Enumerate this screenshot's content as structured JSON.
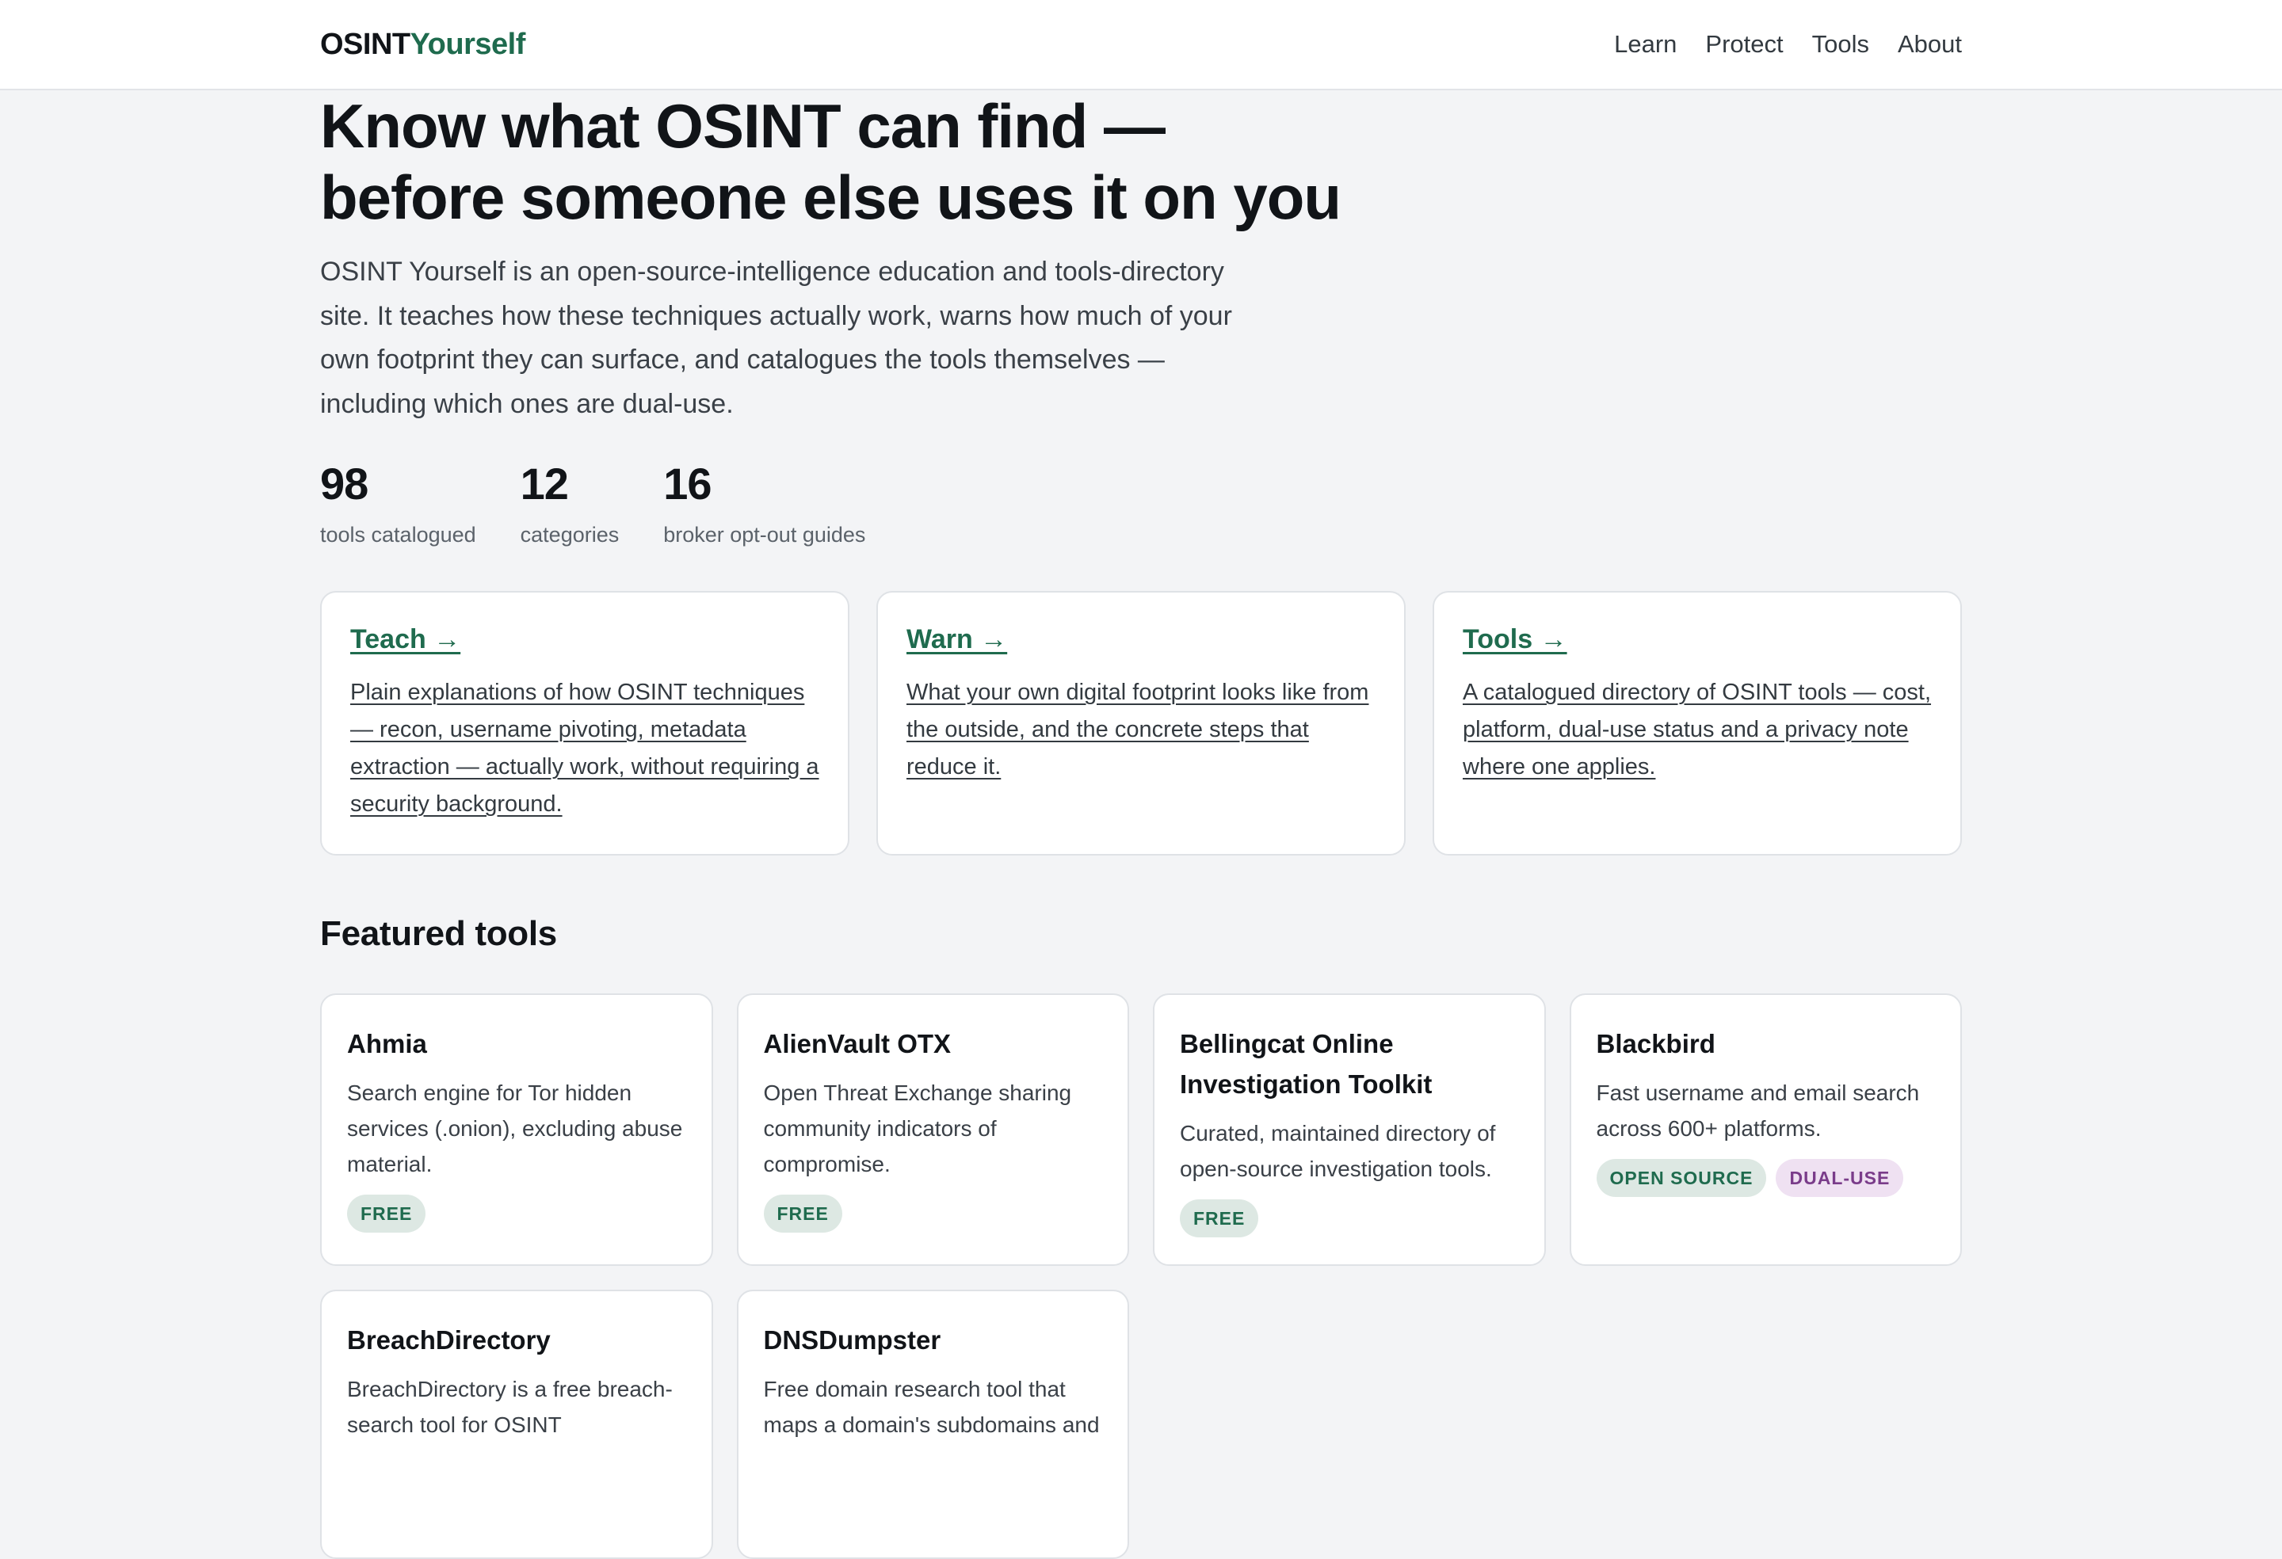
{
  "header": {
    "logo_part1": "OSINT",
    "logo_part2": "Yourself",
    "nav": [
      "Learn",
      "Protect",
      "Tools",
      "About"
    ]
  },
  "hero": {
    "title_line1": "Know what OSINT can find —",
    "title_line2": "before someone else uses it on you",
    "lede": "OSINT Yourself is an open-source-intelligence education and tools-directory site. It teaches how these techniques actually work, warns how much of your own footprint they can surface, and catalogues the tools themselves — including which ones are dual-use."
  },
  "stats": [
    {
      "value": "98",
      "label": "tools catalogued"
    },
    {
      "value": "12",
      "label": "categories"
    },
    {
      "value": "16",
      "label": "broker opt-out guides"
    }
  ],
  "pillars": [
    {
      "title": "Teach →",
      "desc": "Plain explanations of how OSINT techniques — recon, username pivoting, metadata extraction — actually work, without requiring a security background."
    },
    {
      "title": "Warn →",
      "desc": "What your own digital footprint looks like from the outside, and the concrete steps that reduce it."
    },
    {
      "title": "Tools →",
      "desc": "A catalogued directory of OSINT tools — cost, platform, dual-use status and a privacy note where one applies."
    }
  ],
  "featured": {
    "title": "Featured tools",
    "tools": [
      {
        "name": "Ahmia",
        "desc": "Search engine for Tor hidden services (.onion), excluding abuse material.",
        "tags": [
          "FREE"
        ]
      },
      {
        "name": "AlienVault OTX",
        "desc": "Open Threat Exchange sharing community indicators of compromise.",
        "tags": [
          "FREE"
        ]
      },
      {
        "name": "Bellingcat Online Investigation Toolkit",
        "desc": "Curated, maintained directory of open-source investigation tools.",
        "tags": [
          "FREE"
        ]
      },
      {
        "name": "Blackbird",
        "desc": "Fast username and email search across 600+ platforms.",
        "tags": [
          "OPEN SOURCE",
          "DUAL-USE"
        ]
      },
      {
        "name": "BreachDirectory",
        "desc": "BreachDirectory is a free breach-search tool for OSINT",
        "tags": []
      },
      {
        "name": "DNSDumpster",
        "desc": "Free domain research tool that maps a domain's subdomains and",
        "tags": []
      }
    ]
  },
  "colors": {
    "accent": "#1f6b4e",
    "background": "#f3f4f6",
    "card": "#ffffff",
    "dual_use": "#7a3c8a"
  }
}
